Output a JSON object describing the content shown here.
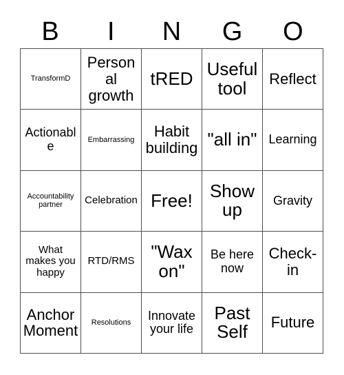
{
  "header": {
    "letters": [
      "B",
      "I",
      "N",
      "G",
      "O"
    ]
  },
  "grid": {
    "rows": 5,
    "columns": 5,
    "border_color": "#4d4d4d",
    "background_color": "#ffffff",
    "text_color": "#000000",
    "cells": [
      {
        "text": "TransformD",
        "size": "xs"
      },
      {
        "text": "Personal growth",
        "size": "l"
      },
      {
        "text": "tRED",
        "size": "xl"
      },
      {
        "text": "Useful tool",
        "size": "xl"
      },
      {
        "text": "Reflect",
        "size": "l"
      },
      {
        "text": "Actionable",
        "size": "m"
      },
      {
        "text": "Embarrassing",
        "size": "xs"
      },
      {
        "text": "Habit building",
        "size": "l"
      },
      {
        "text": "\"all in\"",
        "size": "xl"
      },
      {
        "text": "Learning",
        "size": "m"
      },
      {
        "text": "Accountability partner",
        "size": "xs"
      },
      {
        "text": "Celebration",
        "size": "s"
      },
      {
        "text": "Free!",
        "size": "xl"
      },
      {
        "text": "Show up",
        "size": "xl"
      },
      {
        "text": "Gravity",
        "size": "m"
      },
      {
        "text": "What makes you happy",
        "size": "s"
      },
      {
        "text": "RTD/RMS",
        "size": "s"
      },
      {
        "text": "\"Wax on\"",
        "size": "xl"
      },
      {
        "text": "Be here now",
        "size": "m"
      },
      {
        "text": "Check-in",
        "size": "l"
      },
      {
        "text": "Anchor Moment",
        "size": "l"
      },
      {
        "text": "Resolutions",
        "size": "xs"
      },
      {
        "text": "Innovate your life",
        "size": "m"
      },
      {
        "text": "Past Self",
        "size": "xl"
      },
      {
        "text": "Future",
        "size": "l"
      }
    ]
  }
}
